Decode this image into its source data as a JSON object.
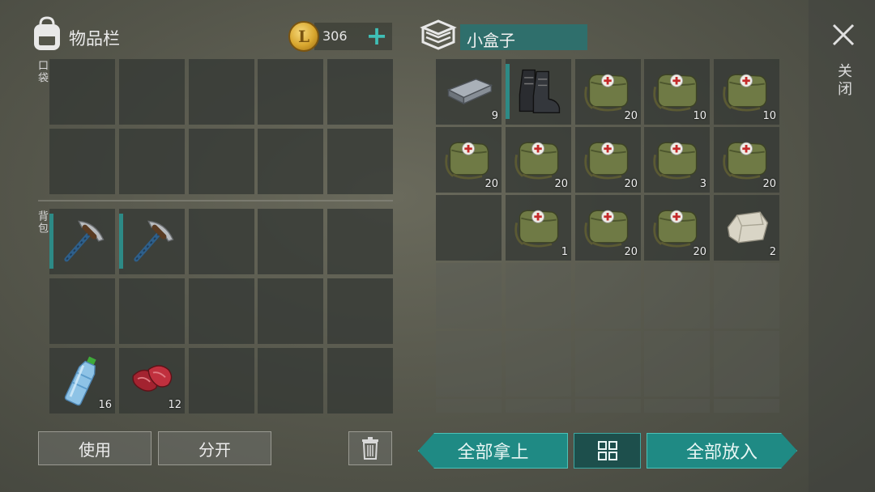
{
  "inventory": {
    "title": "物品栏",
    "coins": "306",
    "add_coin": "+",
    "pockets_label": "口袋",
    "backpack_label": "背包",
    "backpack_items": [
      {
        "name": "pickaxe",
        "count": ""
      },
      {
        "name": "pickaxe",
        "count": ""
      },
      {
        "name": "water-bottle",
        "count": "16"
      },
      {
        "name": "raw-meat",
        "count": "12"
      }
    ]
  },
  "container": {
    "title": "小盒子",
    "items": [
      {
        "name": "iron-bar",
        "count": "9"
      },
      {
        "name": "boots",
        "count": ""
      },
      {
        "name": "medkit-bag",
        "count": "20"
      },
      {
        "name": "medkit-bag",
        "count": "10"
      },
      {
        "name": "medkit-bag",
        "count": "10"
      },
      {
        "name": "medkit-bag",
        "count": "20"
      },
      {
        "name": "medkit-bag",
        "count": "20"
      },
      {
        "name": "medkit-bag",
        "count": "20"
      },
      {
        "name": "medkit-bag",
        "count": "3"
      },
      {
        "name": "medkit-bag",
        "count": "20"
      },
      {
        "name": "medkit-bag",
        "count": "1"
      },
      {
        "name": "medkit-bag",
        "count": "20"
      },
      {
        "name": "medkit-bag",
        "count": "20"
      },
      {
        "name": "stone",
        "count": "2"
      }
    ]
  },
  "buttons": {
    "use": "使用",
    "split": "分开",
    "take_all": "全部拿上",
    "put_all": "全部放入",
    "close": "关闭"
  },
  "colors": {
    "accent": "#1f8a84",
    "slot": "#343834",
    "coin": "#d8a62e"
  }
}
